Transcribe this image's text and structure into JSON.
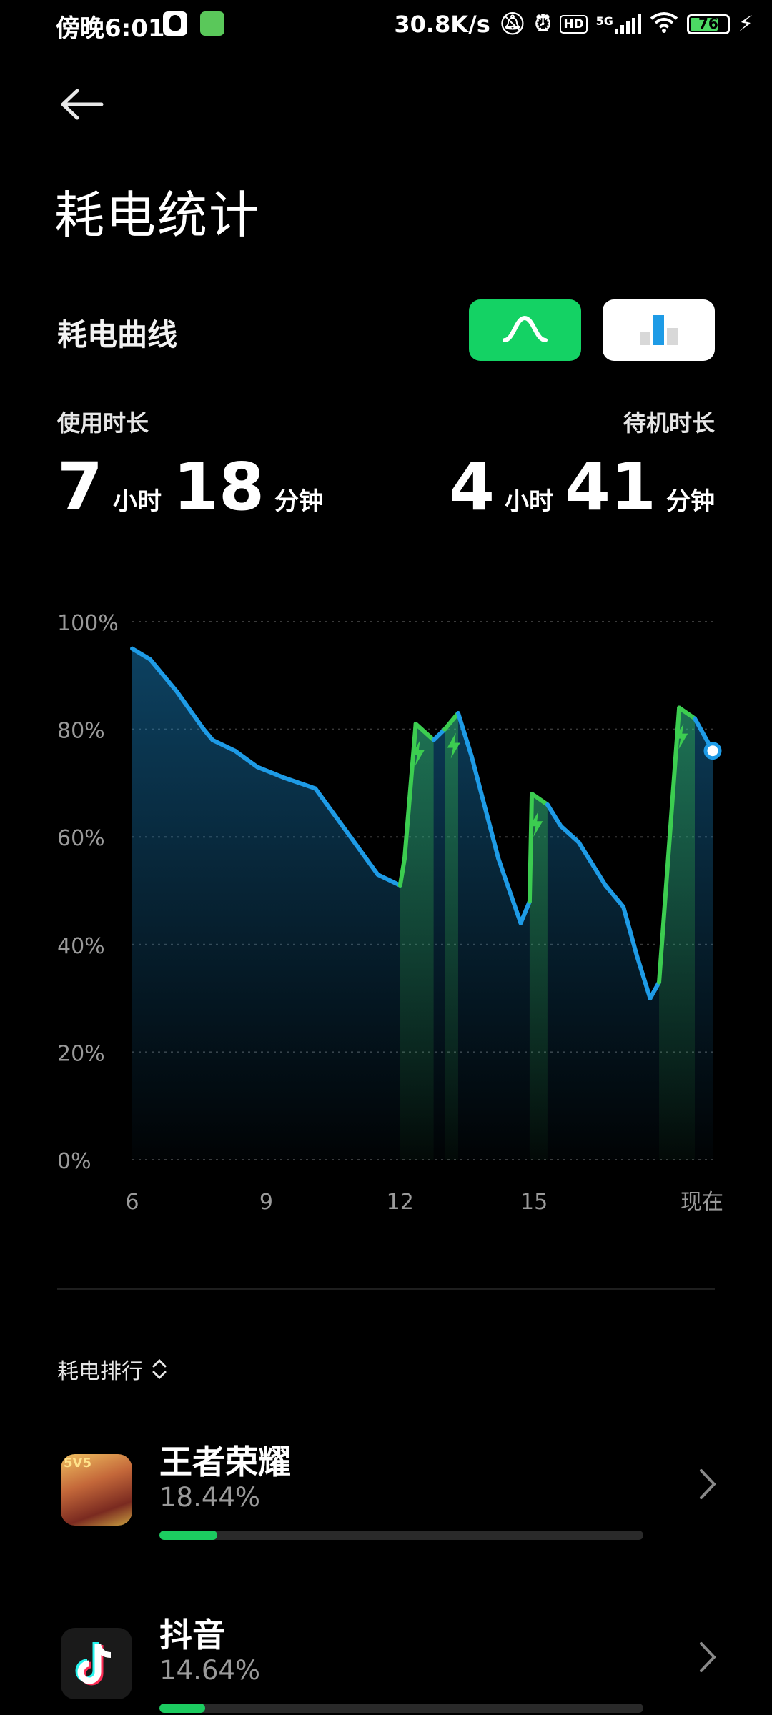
{
  "status_bar": {
    "time": "傍晚6:01",
    "net_speed": "30.8K/s",
    "network": "5G",
    "battery": "76",
    "battery_level": 0.76
  },
  "header": {
    "title": "耗电统计"
  },
  "curve_section": {
    "title": "耗电曲线",
    "usage": {
      "label": "使用时长",
      "hours": "7",
      "hour_unit": "小时",
      "minutes": "18",
      "minute_unit": "分钟"
    },
    "standby": {
      "label": "待机时长",
      "hours": "4",
      "hour_unit": "小时",
      "minutes": "41",
      "minute_unit": "分钟"
    }
  },
  "chart_data": {
    "type": "area",
    "y_tick_labels": [
      "100%",
      "80%",
      "60%",
      "40%",
      "20%",
      "0%"
    ],
    "x_tick_labels": [
      "6",
      "9",
      "12",
      "15",
      "现在"
    ],
    "ylim": [
      0,
      100
    ],
    "grid": true,
    "colors": {
      "discharge": "#1e9be6",
      "charge": "#3ccd50"
    },
    "points": [
      {
        "x": 6.0,
        "y": 95
      },
      {
        "x": 6.4,
        "y": 93
      },
      {
        "x": 7.0,
        "y": 87
      },
      {
        "x": 7.6,
        "y": 80
      },
      {
        "x": 7.8,
        "y": 78
      },
      {
        "x": 8.3,
        "y": 76
      },
      {
        "x": 8.8,
        "y": 73
      },
      {
        "x": 9.4,
        "y": 71
      },
      {
        "x": 10.1,
        "y": 69
      },
      {
        "x": 10.8,
        "y": 61
      },
      {
        "x": 11.5,
        "y": 53
      },
      {
        "x": 12.0,
        "y": 51
      },
      {
        "x": 12.1,
        "y": 56
      },
      {
        "x": 12.35,
        "y": 81
      },
      {
        "x": 12.75,
        "y": 78
      },
      {
        "x": 13.0,
        "y": 80
      },
      {
        "x": 13.3,
        "y": 83
      },
      {
        "x": 13.6,
        "y": 75
      },
      {
        "x": 14.2,
        "y": 56
      },
      {
        "x": 14.7,
        "y": 44
      },
      {
        "x": 14.9,
        "y": 48
      },
      {
        "x": 14.95,
        "y": 68
      },
      {
        "x": 15.3,
        "y": 66
      },
      {
        "x": 15.6,
        "y": 62
      },
      {
        "x": 16.0,
        "y": 59
      },
      {
        "x": 16.6,
        "y": 51
      },
      {
        "x": 17.0,
        "y": 47
      },
      {
        "x": 17.3,
        "y": 38
      },
      {
        "x": 17.6,
        "y": 30
      },
      {
        "x": 17.8,
        "y": 33
      },
      {
        "x": 18.25,
        "y": 84
      },
      {
        "x": 18.6,
        "y": 82
      },
      {
        "x": 19.0,
        "y": 76
      }
    ],
    "charging_ranges": [
      [
        12.0,
        12.75
      ],
      [
        13.0,
        13.3
      ],
      [
        14.9,
        15.3
      ],
      [
        17.8,
        18.6
      ]
    ],
    "charge_markers_x": [
      12.4,
      13.2,
      15.05,
      18.3
    ]
  },
  "ranking": {
    "label": "耗电排行",
    "apps": [
      {
        "name": "王者荣耀",
        "percent_text": "18.44%",
        "percent": 18.44
      },
      {
        "name": "抖音",
        "percent_text": "14.64%",
        "percent": 14.64
      }
    ]
  }
}
